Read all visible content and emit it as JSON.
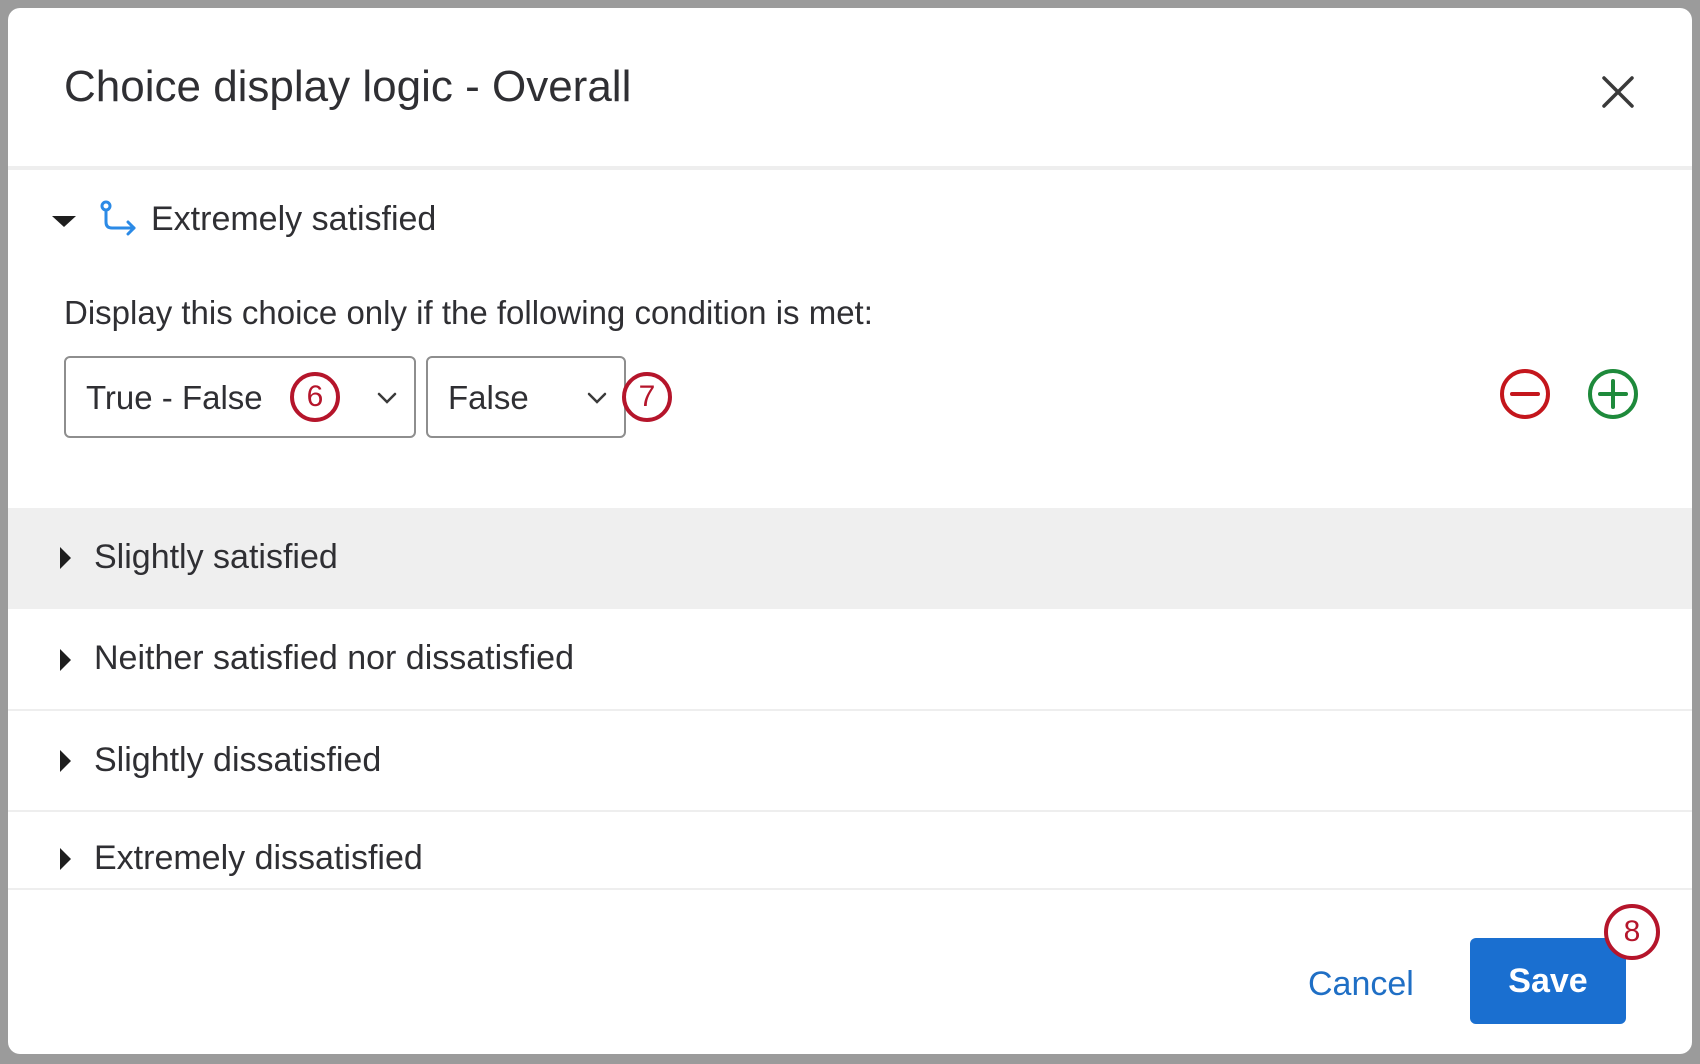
{
  "dialog": {
    "title": "Choice display logic - Overall",
    "close_icon": "close-icon"
  },
  "choices": [
    {
      "label": "Extremely satisfied",
      "expanded": true,
      "condition_text": "Display this choice only if the following condition is met:",
      "question_select": "True - False",
      "value_select": "False",
      "step_badges": [
        "6",
        "7"
      ]
    },
    {
      "label": "Slightly satisfied",
      "highlighted": true
    },
    {
      "label": "Neither satisfied nor dissatisfied"
    },
    {
      "label": "Slightly dissatisfied"
    },
    {
      "label": "Extremely dissatisfied"
    }
  ],
  "footer": {
    "cancel_label": "Cancel",
    "save_label": "Save",
    "save_badge": "8"
  },
  "colors": {
    "primary": "#1a6fd0",
    "badge_red": "#b5152b",
    "remove_red": "#c4161c",
    "add_green": "#1e8a3b",
    "branch_blue": "#2b8ae6"
  }
}
